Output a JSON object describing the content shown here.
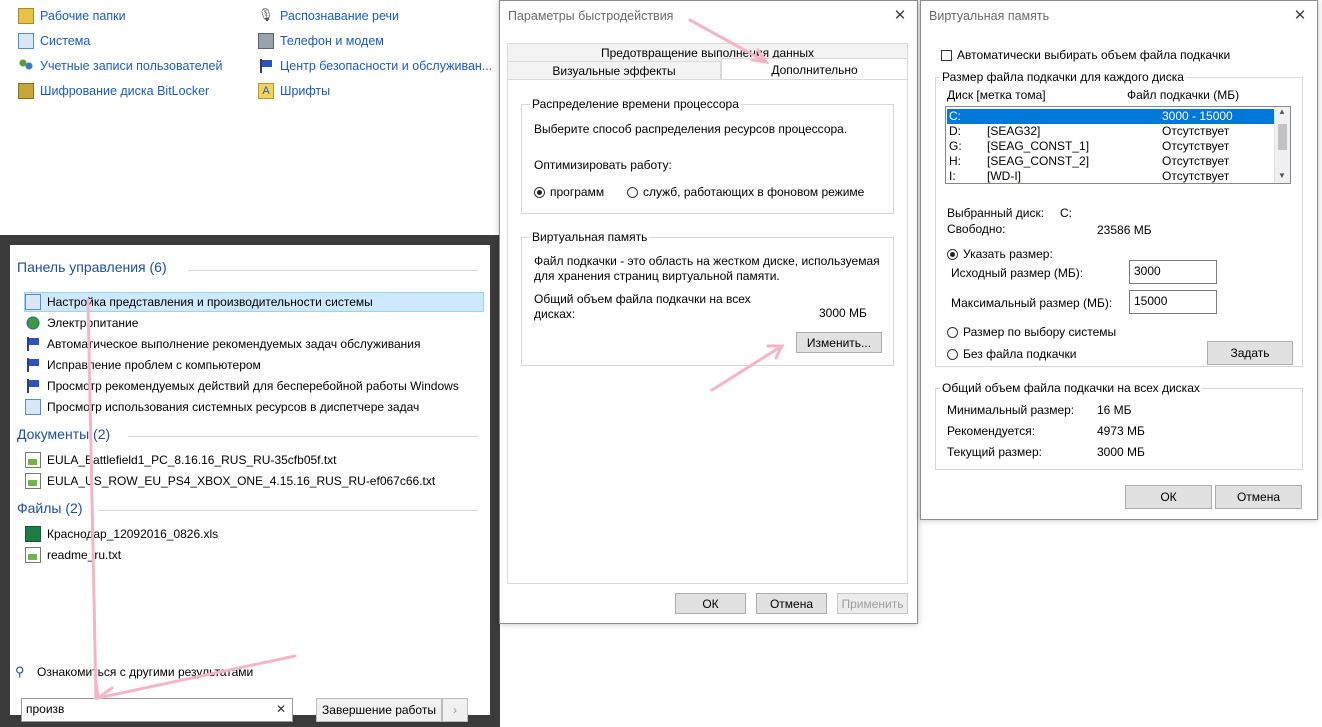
{
  "control_panel": {
    "items_left": [
      "Рабочие папки",
      "Система",
      "Учетные записи пользователей",
      "Шифрование диска BitLocker"
    ],
    "items_right": [
      "Распознавание речи",
      "Телефон и модем",
      "Центр безопасности и обслуживан...",
      "Шрифты"
    ]
  },
  "start_menu": {
    "sections": [
      {
        "title": "Панель управления (6)",
        "items": [
          "Настройка представления и производительности системы",
          "Электропитание",
          "Автоматическое выполнение рекомендуемых задач обслуживания",
          "Исправление проблем с компьютером",
          "Просмотр рекомендуемых действий для бесперебойной работы Windows",
          "Просмотр использования системных ресурсов в диспетчере задач"
        ]
      },
      {
        "title": "Документы (2)",
        "items": [
          "EULA_Battlefield1_PC_8.16.16_RUS_RU-35cfb05f.txt",
          "EULA_US_ROW_EU_PS4_XBOX_ONE_4.15.16_RUS_RU-ef067c66.txt"
        ]
      },
      {
        "title": "Файлы (2)",
        "items": [
          "Краснодар_12092016_0826.xls",
          "readme_ru.txt"
        ]
      }
    ],
    "more_results": "Ознакомиться с другими результатами",
    "search_value": "произв",
    "shutdown_label": "Завершение работы"
  },
  "perf_dialog": {
    "title": "Параметры быстродействия",
    "tabs": {
      "dep": "Предотвращение выполнения данных",
      "visual": "Визуальные эффекты",
      "advanced": "Дополнительно"
    },
    "cpu_group": {
      "title": "Распределение времени процессора",
      "desc": "Выберите способ распределения ресурсов процессора.",
      "optimize_label": "Оптимизировать работу:",
      "opt_programs": "программ",
      "opt_services": "служб, работающих в фоновом режиме"
    },
    "vm_group": {
      "title": "Виртуальная память",
      "desc_line1": "Файл подкачки - это область на жестком диске, используемая",
      "desc_line2": "для хранения страниц виртуальной памяти.",
      "total_line1": "Общий объем файла подкачки на всех",
      "total_line2": "дисках:",
      "total_value": "3000 МБ",
      "change_button": "Изменить..."
    },
    "buttons": {
      "ok": "ОК",
      "cancel": "Отмена",
      "apply": "Применить"
    }
  },
  "vm_dialog": {
    "title": "Виртуальная память",
    "auto_label": "Автоматически выбирать объем файла подкачки",
    "per_disk_group": "Размер файла подкачки для каждого диска",
    "col_disk": "Диск [метка тома]",
    "col_size": "Файл подкачки (МБ)",
    "drives": [
      {
        "letter": "C:",
        "label": "",
        "size": "3000 - 15000"
      },
      {
        "letter": "D:",
        "label": "[SEAG32]",
        "size": "Отсутствует"
      },
      {
        "letter": "G:",
        "label": "[SEAG_CONST_1]",
        "size": "Отсутствует"
      },
      {
        "letter": "H:",
        "label": "[SEAG_CONST_2]",
        "size": "Отсутствует"
      },
      {
        "letter": "I:",
        "label": "[WD-I]",
        "size": "Отсутствует"
      }
    ],
    "selected_disk_label": "Выбранный диск:",
    "selected_disk_value": "C:",
    "free_label": "Свободно:",
    "free_value": "23586 МБ",
    "custom_size_label": "Указать размер:",
    "initial_label": "Исходный размер (МБ):",
    "initial_value": "3000",
    "max_label": "Максимальный размер (МБ):",
    "max_value": "15000",
    "system_size_label": "Размер по выбору системы",
    "no_paging_label": "Без файла подкачки",
    "set_button": "Задать",
    "total_group": "Общий объем файла подкачки на всех дисках",
    "min_label": "Минимальный размер:",
    "min_value": "16 МБ",
    "rec_label": "Рекомендуется:",
    "rec_value": "4973 МБ",
    "cur_label": "Текущий размер:",
    "cur_value": "3000 МБ",
    "ok": "ОК",
    "cancel": "Отмена"
  },
  "colors": {
    "accent": "#0078d7",
    "link": "#1e5bb8",
    "arrow": "#f4b6c6",
    "start_frame": "#3b3b3b"
  }
}
